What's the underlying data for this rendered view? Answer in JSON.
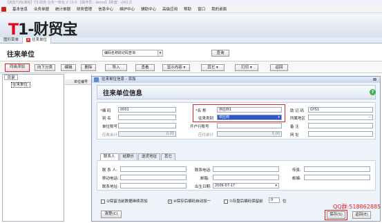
{
  "window_title": "【用友T3标准版】T3-财务·业务一体化 V 10.0 【操作员：demo】【账套：(001)】",
  "menu": [
    "基本信息",
    "业务单据",
    "统计单据",
    "财务管理",
    "信息中心",
    "维护中心",
    "辅助中心",
    "高级应用",
    "帮助",
    "窗口",
    "我的桌面"
  ],
  "logo": {
    "t": "T",
    "rest": "1-财贸宝"
  },
  "tabs": [
    "图形菜单",
    "往来单位"
  ],
  "page_title": "往来单位",
  "search": {
    "value": "编码名称助记码查询",
    "query_label": "查询"
  },
  "toolbar": {
    "add": "同级添加",
    "add_sub": "向下分类",
    "edit": "编辑",
    "delete": "删除",
    "import": "导入",
    "view": "查看",
    "display": "显示内容",
    "other": "其它",
    "print": "打印",
    "back": "返回"
  },
  "left_panel": {
    "tab": "目录",
    "tree_item": "往来单位"
  },
  "grid": {
    "col_header": "单位编号"
  },
  "dialog": {
    "window_title": "往来单位信息 - 添加",
    "heading": "往来单位信息",
    "help": "?",
    "close": "⊠",
    "fields": {
      "code_label": "编    码",
      "code_value": "0001",
      "alias_label": "别    名",
      "account_label": "单位账号",
      "deposit_label": "应收余计",
      "deposit_value": "0.00",
      "name_label": "名    称",
      "name_value": "供应商1",
      "type_label": "往来类别",
      "type_value": "供应商",
      "bank_label": "开户行账号",
      "payable_label": "应付余计",
      "payable_value": "0.00",
      "mnemonic_label": "助 记 码",
      "mnemonic_value": "GYS1",
      "region_label": "所属地区",
      "remark_label": "备    注",
      "web_label": "网    址"
    },
    "subtabs": [
      "联系人",
      "结算价",
      "送货地址",
      "其它"
    ],
    "contact": {
      "person_label": "联 系 人:",
      "mobile_label": "移动电话:",
      "address_label": "联系地址:",
      "phone_label": "联系电话:",
      "email_label": "邮箱:",
      "birthday_label": "出生日期:",
      "birthday_value": "2006-07-17",
      "fax_label": "传真:",
      "zip_label": "邮编:"
    },
    "options": {
      "keep_label": "①保留当前数据继续添加",
      "auto_code_label": "④保存后编码自动加一",
      "keep_checked": "",
      "auto_checked": "✓",
      "keep_digits_label": "⑦存盘后编码保留前",
      "digits_value": "0",
      "digits_unit": "位"
    },
    "clear": "清楚(C)",
    "save": "保存(S)",
    "back": "返回(E)"
  },
  "watermark": "QQ群:518862885",
  "colors": {
    "accent_red": "#e02020",
    "selected_blue": "#3355cc",
    "help_green": "#3db34a"
  }
}
